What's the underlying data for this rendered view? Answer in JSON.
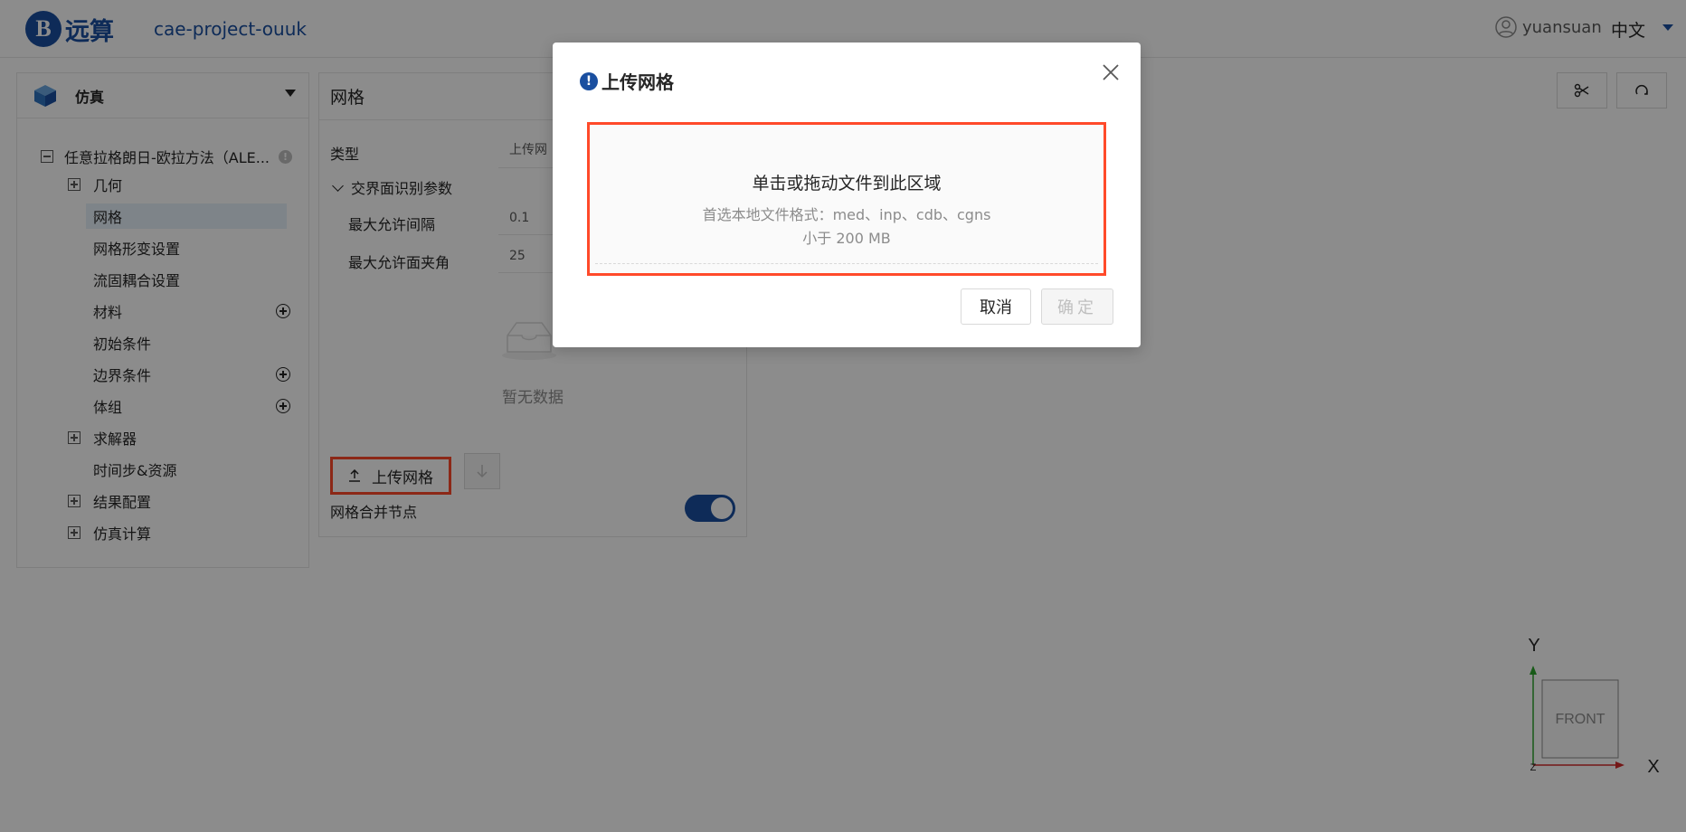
{
  "header": {
    "logo_text": "远算",
    "project_name": "cae-project-ouuk",
    "user_name": "yuansuan",
    "language": "中文"
  },
  "tree": {
    "header_label": "仿真",
    "root_label": "任意拉格朗日-欧拉方法（ALE...",
    "items": [
      {
        "label": "几何"
      },
      {
        "label": "网格"
      },
      {
        "label": "网格形变设置"
      },
      {
        "label": "流固耦合设置"
      },
      {
        "label": "材料"
      },
      {
        "label": "初始条件"
      },
      {
        "label": "边界条件"
      },
      {
        "label": "体组"
      },
      {
        "label": "求解器"
      },
      {
        "label": "时间步&资源"
      },
      {
        "label": "结果配置"
      },
      {
        "label": "仿真计算"
      }
    ]
  },
  "mesh_panel": {
    "title": "网格",
    "type_label": "类型",
    "type_value": "上传网",
    "section_label": "交界面识别参数",
    "max_gap_label": "最大允许间隔",
    "max_gap_value": "0.1",
    "max_angle_label": "最大允许面夹角",
    "max_angle_value": "25",
    "empty_text": "暂无数据",
    "upload_button": "上传网格",
    "merge_nodes_label": "网格合并节点",
    "merge_nodes_enabled": true
  },
  "viewer": {
    "axis_x": "X",
    "axis_y": "Y",
    "axis_z": "Z",
    "view_cube_label": "FRONT"
  },
  "modal": {
    "title": "上传网格",
    "dropzone_main": "单击或拖动文件到此区域",
    "dropzone_hint": "首选本地文件格式：med、inp、cdb、cgns",
    "dropzone_size": "小于 200 MB",
    "cancel_label": "取消",
    "ok_label": "确定"
  },
  "colors": {
    "brand": "#1a4fa0",
    "highlight_border": "#ff4a2a",
    "axis_x": "#d42b2b",
    "axis_y": "#2aa52a"
  }
}
